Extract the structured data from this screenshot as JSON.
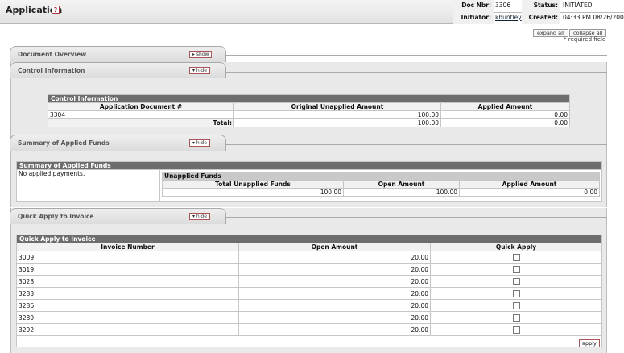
{
  "header": {
    "title": "Application",
    "help": "?",
    "doc_nbr_label": "Doc Nbr:",
    "doc_nbr": "3306",
    "status_label": "Status:",
    "status": "INITIATED",
    "initiator_label": "Initiator:",
    "initiator": "khuntley",
    "created_label": "Created:",
    "created": "04:33 PM 08/26/2009"
  },
  "controls": {
    "expand_all": "expand all",
    "collapse_all": "collapse all",
    "required": "* required field"
  },
  "tabs": {
    "overview": {
      "label": "Document Overview",
      "btn": "show"
    },
    "control": {
      "label": "Control Information",
      "btn": "hide"
    },
    "summary": {
      "label": "Summary of Applied Funds",
      "btn": "hide"
    },
    "quick": {
      "label": "Quick Apply to Invoice",
      "btn": "hide"
    }
  },
  "control_info": {
    "title": "Control Information",
    "headers": [
      "Application Document #",
      "Original Unapplied Amount",
      "Applied Amount"
    ],
    "doc": "3304",
    "original": "100.00",
    "applied": "0.00",
    "total_label": "Total:",
    "total_original": "100.00",
    "total_applied": "0.00"
  },
  "summary": {
    "title": "Summary of Applied Funds",
    "no_payments": "No applied payments.",
    "unapplied_title": "Unapplied Funds",
    "headers": [
      "Total Unapplied Funds",
      "Open Amount",
      "Applied Amount"
    ],
    "total_unapplied": "100.00",
    "open": "100.00",
    "applied": "0.00"
  },
  "quick": {
    "title": "Quick Apply to Invoice",
    "headers": [
      "Invoice Number",
      "Open Amount",
      "Quick Apply"
    ],
    "rows": [
      {
        "inv": "3009",
        "amt": "20.00"
      },
      {
        "inv": "3019",
        "amt": "20.00"
      },
      {
        "inv": "3028",
        "amt": "20.00"
      },
      {
        "inv": "3283",
        "amt": "20.00"
      },
      {
        "inv": "3286",
        "amt": "20.00"
      },
      {
        "inv": "3289",
        "amt": "20.00"
      },
      {
        "inv": "3292",
        "amt": "20.00"
      }
    ],
    "apply": "apply"
  }
}
